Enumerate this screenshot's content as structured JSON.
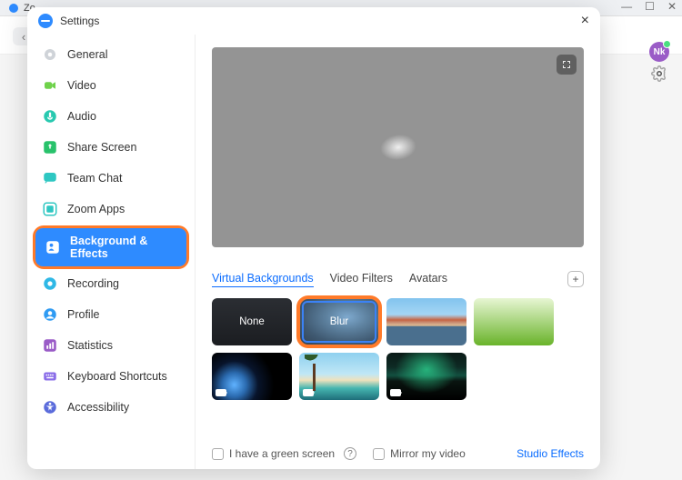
{
  "browser": {
    "tab_title": "Zo"
  },
  "user": {
    "avatar_initials": "Nk"
  },
  "settings": {
    "title": "Settings",
    "sidebar": [
      {
        "name": "general",
        "label": "General",
        "color": "#cfd3d8"
      },
      {
        "name": "video",
        "label": "Video",
        "color": "#6fd24b"
      },
      {
        "name": "audio",
        "label": "Audio",
        "color": "#28c9b0"
      },
      {
        "name": "share",
        "label": "Share Screen",
        "color": "#28c26b"
      },
      {
        "name": "chat",
        "label": "Team Chat",
        "color": "#2ec7c2"
      },
      {
        "name": "apps",
        "label": "Zoom Apps",
        "color": "#2ec7c2"
      },
      {
        "name": "bg",
        "label": "Background & Effects",
        "color": "#ffffff",
        "active": true,
        "highlight": true
      },
      {
        "name": "recording",
        "label": "Recording",
        "color": "#2fb8e6"
      },
      {
        "name": "profile",
        "label": "Profile",
        "color": "#2f9bf3"
      },
      {
        "name": "stats",
        "label": "Statistics",
        "color": "#9a5cc7"
      },
      {
        "name": "keyboard",
        "label": "Keyboard Shortcuts",
        "color": "#8a6de8"
      },
      {
        "name": "a11y",
        "label": "Accessibility",
        "color": "#5a6bdb"
      }
    ],
    "content": {
      "tabs": [
        {
          "name": "virtual-backgrounds",
          "label": "Virtual Backgrounds",
          "active": true
        },
        {
          "name": "video-filters",
          "label": "Video Filters"
        },
        {
          "name": "avatars",
          "label": "Avatars"
        }
      ],
      "backgrounds": [
        {
          "name": "none",
          "label": "None",
          "css": "none"
        },
        {
          "name": "blur",
          "label": "Blur",
          "css": "blur",
          "selected": true
        },
        {
          "name": "bridge",
          "label": "",
          "css": "bridge"
        },
        {
          "name": "grass",
          "label": "",
          "css": "grass"
        },
        {
          "name": "earth",
          "label": "",
          "css": "earth",
          "cam": true
        },
        {
          "name": "beach",
          "label": "",
          "css": "beach",
          "cam": true
        },
        {
          "name": "aurora",
          "label": "",
          "css": "aurora",
          "cam": true
        }
      ],
      "footer": {
        "green_screen_label": "I have a green screen",
        "mirror_label": "Mirror my video",
        "studio_effects_label": "Studio Effects"
      }
    }
  }
}
